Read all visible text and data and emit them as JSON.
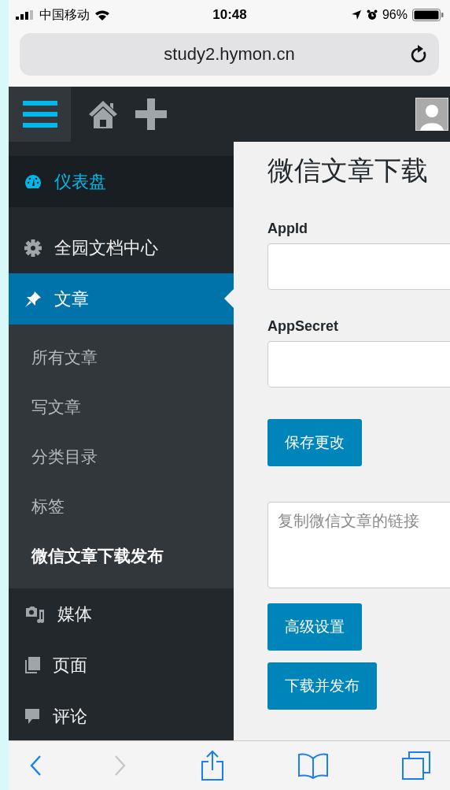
{
  "status_bar": {
    "carrier": "中国移动",
    "time": "10:48",
    "battery": "96%"
  },
  "address_bar": {
    "url": "study2.hymon.cn"
  },
  "sidebar": {
    "items": [
      {
        "label": "仪表盘",
        "selected": false,
        "hovered": true
      },
      {
        "label": "全园文档中心",
        "selected": false,
        "hovered": false
      },
      {
        "label": "文章",
        "selected": true,
        "hovered": false,
        "children": [
          {
            "label": "所有文章",
            "selected": false
          },
          {
            "label": "写文章",
            "selected": false
          },
          {
            "label": "分类目录",
            "selected": false
          },
          {
            "label": "标签",
            "selected": false
          },
          {
            "label": "微信文章下载发布",
            "selected": true
          }
        ]
      },
      {
        "label": "媒体",
        "selected": false,
        "hovered": false
      },
      {
        "label": "页面",
        "selected": false,
        "hovered": false
      },
      {
        "label": "评论",
        "selected": false,
        "hovered": false
      }
    ]
  },
  "content": {
    "title": "微信文章下载",
    "fields": [
      {
        "label": "AppId"
      },
      {
        "label": "AppSecret"
      }
    ],
    "save_button": "保存更改",
    "link_box": {
      "placeholder": "复制微信文章的链接"
    },
    "buttons": [
      "高级设置",
      "下载并发布"
    ]
  },
  "toolbar": {
    "back": {
      "disabled": false
    },
    "forward": {
      "disabled": true
    }
  }
}
